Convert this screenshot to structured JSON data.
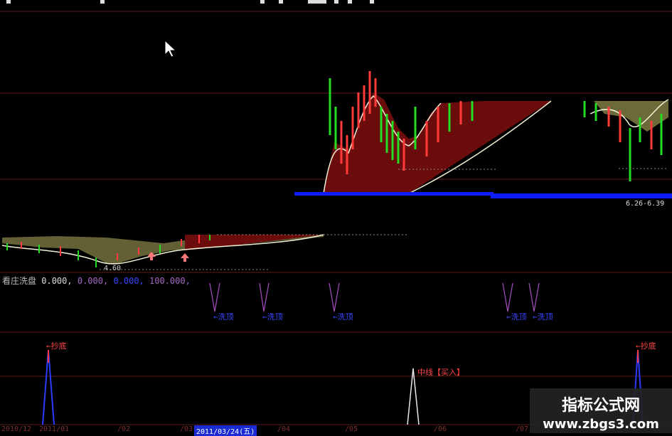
{
  "panels": {
    "main": {
      "price_label_low": "4.60",
      "price_range_label": "6.26-6.39"
    },
    "indicator": {
      "name": "看庄洗盘",
      "v1": "0.000,",
      "v2": "0.000,",
      "v3": "0.000,",
      "v4": "100.000,",
      "signal_label": "←洗顶"
    },
    "signals": {
      "left_label": "←抄底",
      "mid_label": "中线【买入】",
      "right_label": "←抄底"
    },
    "date_axis": {
      "cells": [
        "2010/12",
        "2011/01",
        "/02",
        "/03",
        "2011/03/24(五)",
        "/04",
        "/05",
        "/06",
        "/07"
      ],
      "selected_index": 4
    }
  },
  "watermark": {
    "title": "指标公式网",
    "url": "www.zbgs3.com"
  },
  "colors": {
    "grid": "#5a1a1a",
    "up_candle": "#ff3b3b",
    "down_candle": "#22dd22",
    "fill_dark_red": "#6b0d0d",
    "fill_olive": "#6d6a3a",
    "ma_line": "#f2f2d8",
    "support_line": "#0f1cff",
    "signal_purple": "#9c4bb3",
    "signal_blue": "#2b3cff"
  }
}
